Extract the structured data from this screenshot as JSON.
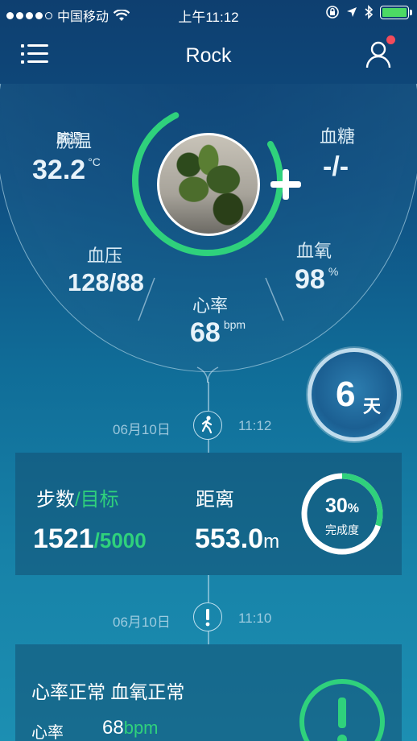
{
  "status_bar": {
    "carrier": "中国移动",
    "time": "上午11:12"
  },
  "nav": {
    "title": "Rock"
  },
  "metrics": {
    "wrist_temp": {
      "label": "腕温",
      "value": "32.2",
      "unit": "°C"
    },
    "blood_sugar": {
      "label": "血糖",
      "value": "-/-"
    },
    "blood_pressure": {
      "label": "血压",
      "value": "128/88"
    },
    "blood_oxygen": {
      "label": "血氧",
      "value": "98",
      "unit": "%"
    },
    "heart_rate": {
      "label": "心率",
      "value": "68",
      "unit": "bpm"
    }
  },
  "streak": {
    "days": "6",
    "unit": "天"
  },
  "timeline": [
    {
      "date": "06月10日",
      "time": "11:12",
      "icon": "walking-icon"
    },
    {
      "date": "06月10日",
      "time": "11:10",
      "icon": "alert-icon"
    }
  ],
  "steps_card": {
    "steps_label": "步数",
    "target_label": "/目标",
    "steps_value": "1521",
    "target_value": "/5000",
    "distance_label": "距离",
    "distance_value": "553.0",
    "distance_unit": "m",
    "progress_percent": 30,
    "progress_text": "30",
    "progress_symbol": "%",
    "progress_caption": "完成度"
  },
  "health_card": {
    "title": "心率正常 血氧正常",
    "hr_label": "心率",
    "hr_value": "68",
    "hr_unit": "bpm"
  },
  "colors": {
    "accent_green": "#2fd17c",
    "badge_red": "#f24b5b"
  }
}
